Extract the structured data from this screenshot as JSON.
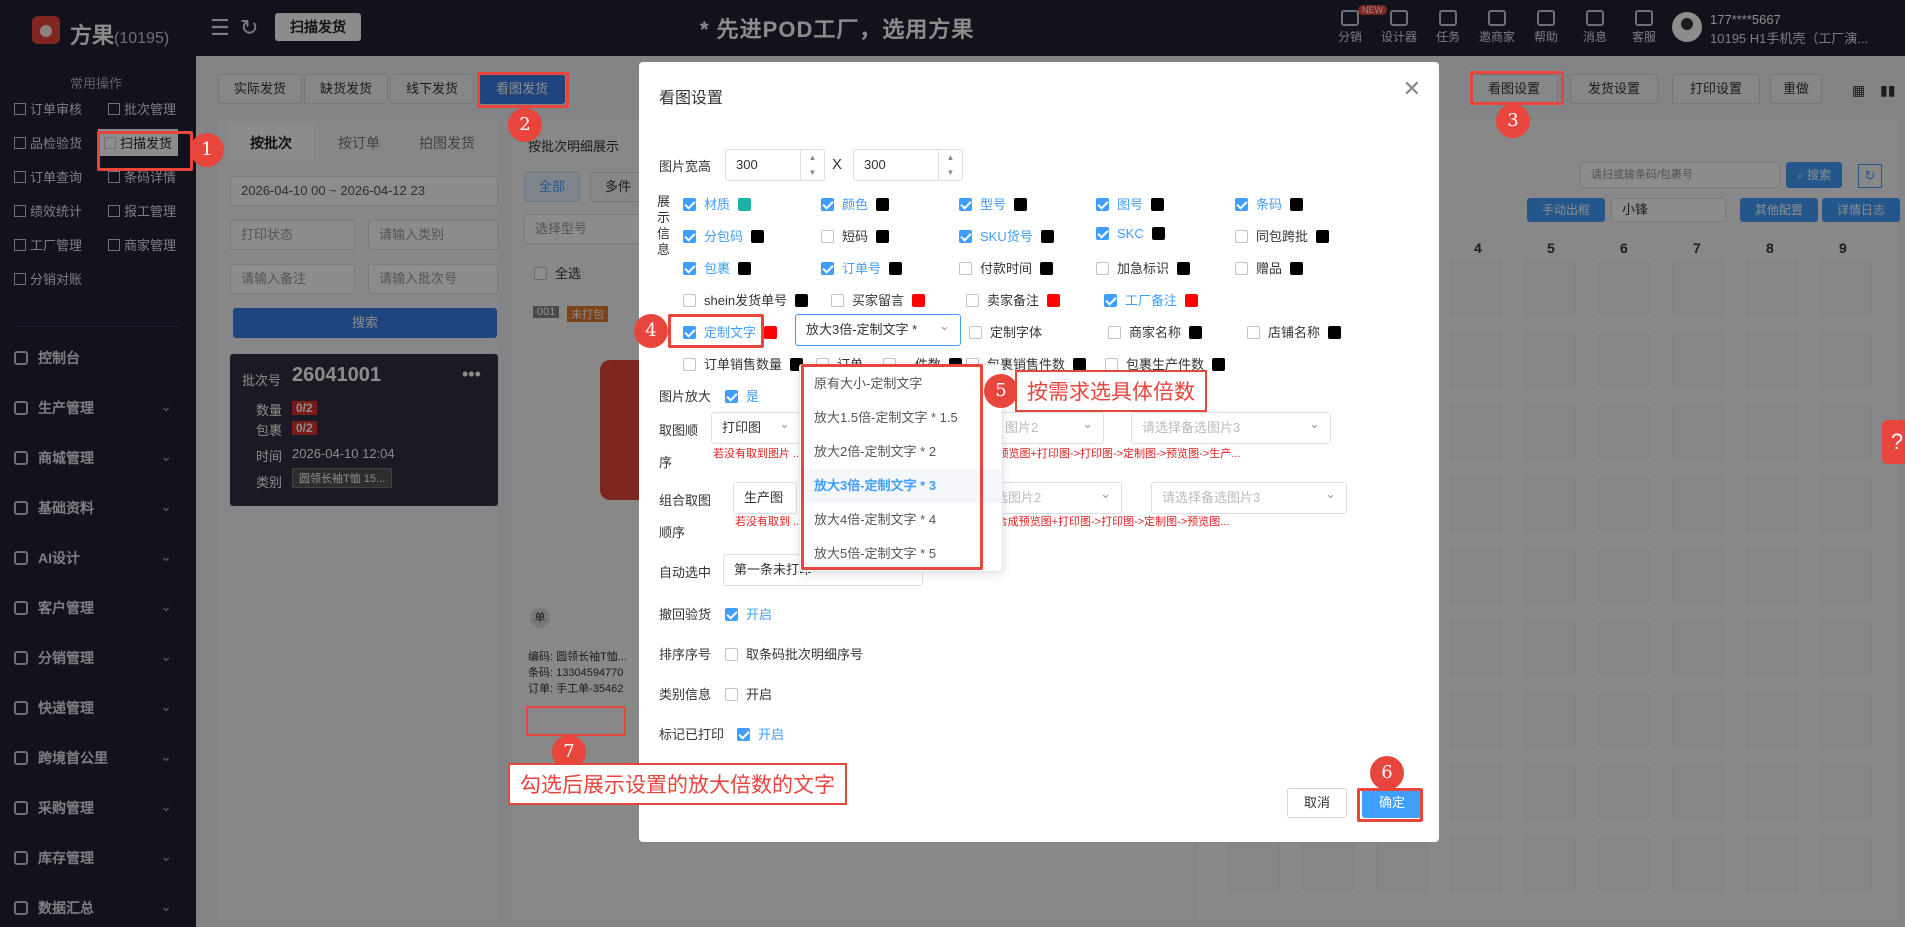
{
  "topbar": {
    "brand": "方果",
    "brand_id": "(10195)",
    "scan_chip": "扫描发货",
    "banner": "* 先进POD工厂，选用方果",
    "nav": [
      {
        "label": "分销",
        "icon": "share-icon"
      },
      {
        "label": "设计器",
        "icon": "image-icon"
      },
      {
        "label": "任务",
        "icon": "task-icon"
      },
      {
        "label": "邀商家",
        "icon": "users-icon"
      },
      {
        "label": "帮助",
        "icon": "help-icon"
      },
      {
        "label": "消息",
        "icon": "message-icon"
      },
      {
        "label": "客服",
        "icon": "service-icon"
      }
    ],
    "new_badge": "NEW",
    "user_phone": "177****5667",
    "user_line2": "10195  H1手机壳（工厂演..."
  },
  "sidebar": {
    "head": "常用操作",
    "quick": [
      "订单审核",
      "批次管理",
      "品检验货",
      "扫描发货",
      "订单查询",
      "条码详情",
      "绩效统计",
      "报工管理",
      "工厂管理",
      "商家管理",
      "分销对账"
    ],
    "menu": [
      "控制台",
      "生产管理",
      "商城管理",
      "基础资料",
      "AI设计",
      "客户管理",
      "分销管理",
      "快递管理",
      "跨境首公里",
      "采购管理",
      "库存管理",
      "数据汇总"
    ]
  },
  "main": {
    "tabs": [
      "实际发货",
      "缺货发货",
      "线下发货",
      "看图发货"
    ],
    "subtabs": [
      "按批次",
      "按订单",
      "拍图发货"
    ],
    "detail_label": "按批次明细展示",
    "filter_tabs": [
      "全部",
      "多件"
    ],
    "date_range": "2026-04-10 00 ~ 2026-04-12 23",
    "print_status_ph": "打印状态",
    "category_ph": "请输入类别",
    "remark_ph": "请输入备注",
    "batch_ph": "请输入批次号",
    "search_btn": "搜索",
    "model_ph": "选择型号",
    "select_all": "全选",
    "batch_card": {
      "batch_label": "批次号",
      "batch_no": "26041001",
      "qty_label": "数量",
      "qty": "0/2",
      "pkg_label": "包裹",
      "pkg": "0/2",
      "time_label": "时间",
      "time": "2026-04-10 12:04",
      "cat_label": "类别",
      "cat": "圆领长袖T恤 15..."
    },
    "item_no": "001",
    "unprinted": "未打包",
    "item_code": "编码: 圆领长袖T恤...",
    "item_barcode": "条码: 13304594770",
    "item_order": "订单: 手工单-35462",
    "single_badge": "单",
    "right_buttons": [
      "看图设置",
      "发货设置",
      "打印设置",
      "重做"
    ],
    "right_search_ph": "请扫或输条码/包裹号",
    "right_search_btn": "搜索",
    "manual_btn": "手动出框",
    "size_select": "小锋",
    "other_btn": "其他配置",
    "log_btn": "详情日志",
    "grid_cols": [
      "4",
      "5",
      "6",
      "7",
      "8",
      "9"
    ]
  },
  "modal": {
    "title": "看图设置",
    "width_label": "图片宽高",
    "width": "300",
    "height": "300",
    "x": "X",
    "info_label": "展示信息",
    "checkboxes": [
      {
        "label": "材质",
        "on": true,
        "color": "#1ab3a5"
      },
      {
        "label": "颜色",
        "on": true,
        "color": "#000000"
      },
      {
        "label": "型号",
        "on": true,
        "color": "#000000"
      },
      {
        "label": "图号",
        "on": true,
        "color": "#000000"
      },
      {
        "label": "条码",
        "on": true,
        "color": "#000000"
      },
      {
        "label": "分包码",
        "on": true,
        "color": "#000000"
      },
      {
        "label": "短码",
        "on": false,
        "color": "#000000"
      },
      {
        "label": "SKU货号",
        "on": true,
        "color": "#000000"
      },
      {
        "label": "SKC",
        "on": true,
        "color": "#000000"
      },
      {
        "label": "同包跨批",
        "on": false,
        "color": "#000000"
      },
      {
        "label": "包裹",
        "on": true,
        "color": "#000000"
      },
      {
        "label": "订单号",
        "on": true,
        "color": "#000000"
      },
      {
        "label": "付款时间",
        "on": false,
        "color": "#000000"
      },
      {
        "label": "加急标识",
        "on": false,
        "color": "#000000"
      },
      {
        "label": "赠品",
        "on": false,
        "color": "#000000"
      },
      {
        "label": "shein发货单号",
        "on": false,
        "color": "#000000"
      },
      {
        "label": "买家留言",
        "on": false,
        "color": "#ff0000"
      },
      {
        "label": "卖家备注",
        "on": false,
        "color": "#ff0000"
      },
      {
        "label": "工厂备注",
        "on": true,
        "color": "#ff0000"
      },
      {
        "label": "定制文字",
        "on": true,
        "color": "#ff0000"
      },
      {
        "label": "定制字体",
        "on": false,
        "color": ""
      },
      {
        "label": "商家名称",
        "on": false,
        "color": "#000000"
      },
      {
        "label": "店铺名称",
        "on": false,
        "color": "#000000"
      },
      {
        "label": "订单销售数量",
        "on": false,
        "color": "#000000"
      },
      {
        "label": "订单...",
        "on": false,
        "color": ""
      },
      {
        "label": "...件数",
        "on": false,
        "color": "#000000"
      },
      {
        "label": "包裹销售件数",
        "on": false,
        "color": "#000000"
      },
      {
        "label": "包裹生产件数",
        "on": false,
        "color": "#000000"
      }
    ],
    "custom_text_select": "放大3倍-定制文字 *",
    "zoom_label": "图片放大",
    "zoom_value": "是",
    "fetch_label": "取图顺",
    "fetch_label2": "序",
    "fetch_value": "打印图",
    "alt2_ph": "图片2",
    "alt3_ph": "请选择备选图片3",
    "fetch_hint": "若没有取到图片  ...本地图->合成预览图->合成打印图->合成预览图+打印图->打印图->定制图->预览图->生产...",
    "combo_label": "组合取图",
    "combo_label2": "顺序",
    "combo_value": "生产图",
    "combo_alt2_ph": "选图片2",
    "combo_alt3_ph": "请选择备选图片3",
    "combo_hint": "若没有取到 ...图->本地图->合成预览图->合成打印图->合成预览图+打印图->打印图->定制图->预览图...",
    "auto_label": "自动选中",
    "auto_value": "第一条未打印",
    "undo_label": "撤回验货",
    "undo_value": "开启",
    "sort_label": "排序序号",
    "sort_value": "取条码批次明细序号",
    "cat_label": "类别信息",
    "cat_value": "开启",
    "mark_label": "标记已打印",
    "mark_value": "开启",
    "cancel": "取消",
    "confirm": "确定",
    "dropdown": [
      "原有大小-定制文字",
      "放大1.5倍-定制文字 * 1.5",
      "放大2倍-定制文字 * 2",
      "放大3倍-定制文字 * 3",
      "放大4倍-定制文字 * 4",
      "放大5倍-定制文字 * 5"
    ],
    "dropdown_selected": 3
  },
  "annotations": {
    "n1": "1",
    "n2": "2",
    "n3": "3",
    "n4": "4",
    "n5": "5",
    "n6": "6",
    "n7": "7",
    "t5": "按需求选具体倍数",
    "t7": "勾选后展示设置的放大倍数的文字"
  },
  "colors": {
    "accent": "#409eff",
    "annotation": "#e8453c",
    "sidebar": "#1f2233"
  }
}
